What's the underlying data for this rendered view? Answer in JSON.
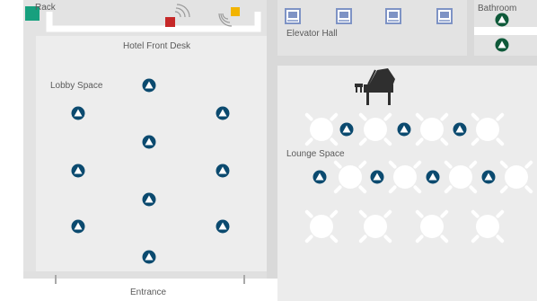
{
  "labels": {
    "rack": "Rack",
    "front_desk": "Hotel Front Desk",
    "elevator_hall": "Elevator Hall",
    "bathroom": "Bathroom",
    "lobby": "Lobby Space",
    "lounge": "Lounge Space",
    "entrance": "Entrance"
  },
  "legend_colors": {
    "access_point": "#0b4a6f",
    "bathroom_access_point": "#0f5a3a",
    "rack": "#17a07e",
    "red_device": "#c62828",
    "yellow_device": "#f2b400",
    "elevator": "#7e93c5",
    "floor": "#ececec",
    "wall": "#d6d6d6"
  },
  "devices": {
    "lobby_access_points": 10,
    "lounge_access_points": 7,
    "bathroom_access_points": 2,
    "elevators": 4,
    "lounge_tables": 15
  }
}
